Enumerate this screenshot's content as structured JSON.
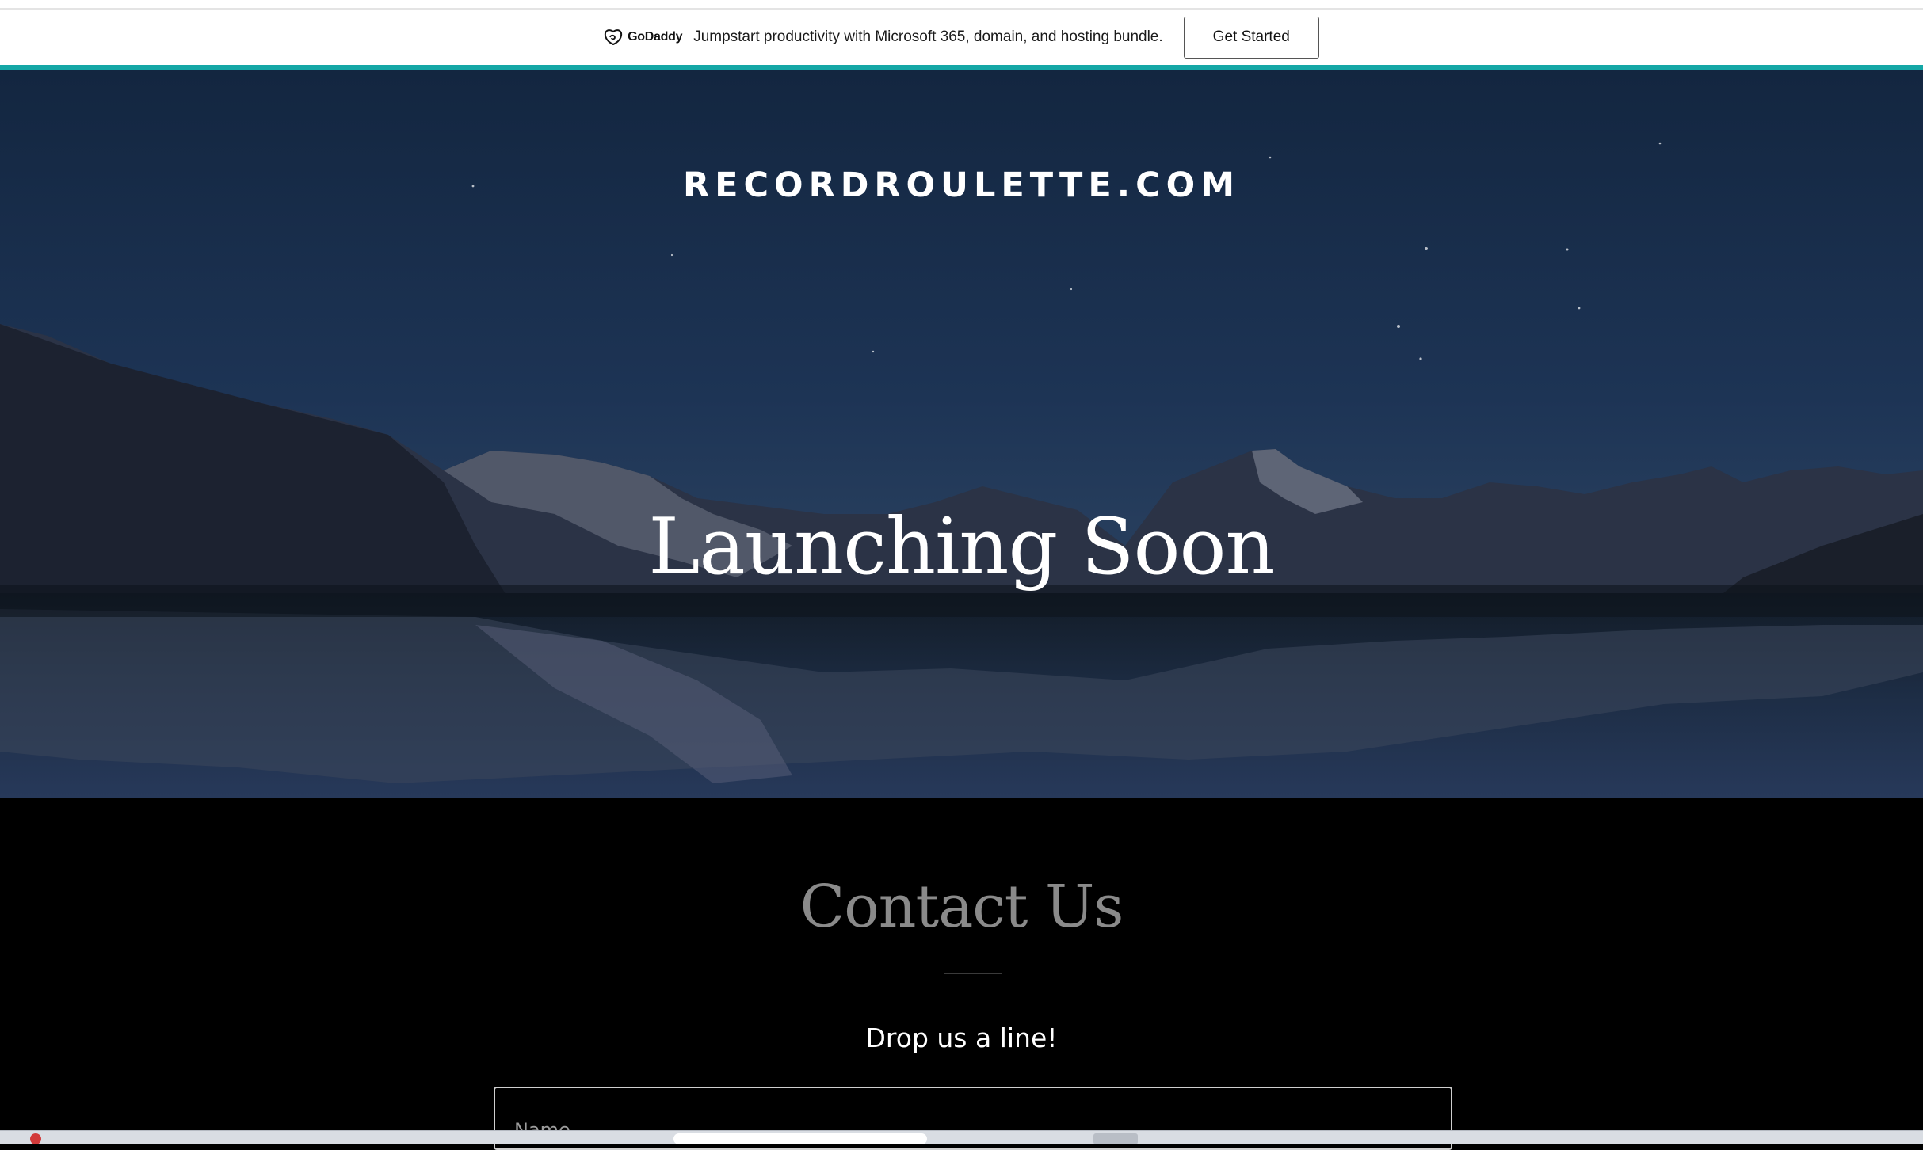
{
  "promo": {
    "brand": "GoDaddy",
    "text": "Jumpstart productivity with Microsoft 365, domain, and hosting bundle.",
    "cta_label": "Get Started"
  },
  "hero": {
    "site_title": "RECORDROULETTE.COM",
    "headline": "Launching Soon"
  },
  "contact": {
    "title": "Contact Us",
    "subtitle": "Drop us a line!",
    "name_placeholder": "Name"
  },
  "colors": {
    "accent_teal": "#14a7a6",
    "hero_sky": "#1b3152",
    "contact_bg": "#000000"
  }
}
